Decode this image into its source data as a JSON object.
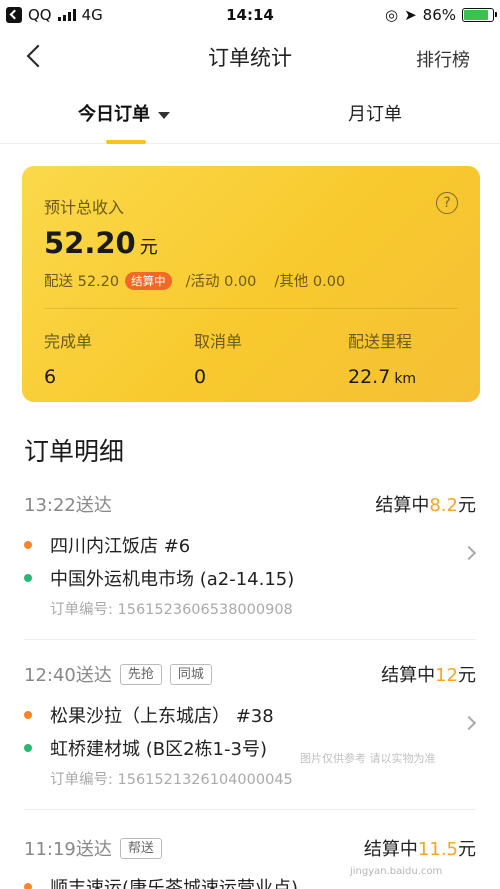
{
  "status_bar": {
    "carrier": "QQ",
    "network": "4G",
    "time": "14:14",
    "battery": "86%",
    "battery_level": 0.86
  },
  "nav": {
    "title": "订单统计",
    "right_label": "排行榜"
  },
  "tabs": [
    {
      "label": "今日订单",
      "active": true
    },
    {
      "label": "月订单",
      "active": false
    }
  ],
  "summary": {
    "label": "预计总收入",
    "help": "?",
    "amount": "52.20",
    "unit": "元",
    "delivery": "配送 52.20",
    "settle_badge": "结算中",
    "activity": "/活动 0.00",
    "other": "/其他 0.00",
    "stats": [
      {
        "label": "完成单",
        "value": "6",
        "unit": ""
      },
      {
        "label": "取消单",
        "value": "0",
        "unit": ""
      },
      {
        "label": "配送里程",
        "value": "22.7",
        "unit": "km"
      }
    ]
  },
  "details": {
    "title": "订单明细",
    "orders": [
      {
        "time": "13:22送达",
        "tags": [],
        "status_prefix": "结算中",
        "amount": "8.2",
        "amount_unit": "元",
        "pickup": "四川内江饭店 #6",
        "dropoff": "中国外运机电市场 (a2-14.15)",
        "order_id": "订单编号: 1561523606538000908"
      },
      {
        "time": "12:40送达",
        "tags": [
          "先抢",
          "同城"
        ],
        "status_prefix": "结算中",
        "amount": "12",
        "amount_unit": "元",
        "pickup": "松果沙拉（上东城店） #38",
        "dropoff": "虹桥建材城 (B区2栋1-3号)",
        "order_id": "订单编号: 1561521326104000045"
      },
      {
        "time": "11:19送达",
        "tags": [
          "帮送"
        ],
        "status_prefix": "结算中",
        "amount": "11.5",
        "amount_unit": "元",
        "pickup": "顺丰速运(康乐茶城速运营业点)",
        "dropoff": "",
        "order_id": ""
      }
    ]
  },
  "watermark": "图片仅供参考 请以实物为准",
  "watermark_url": "jingyan.baidu.com"
}
